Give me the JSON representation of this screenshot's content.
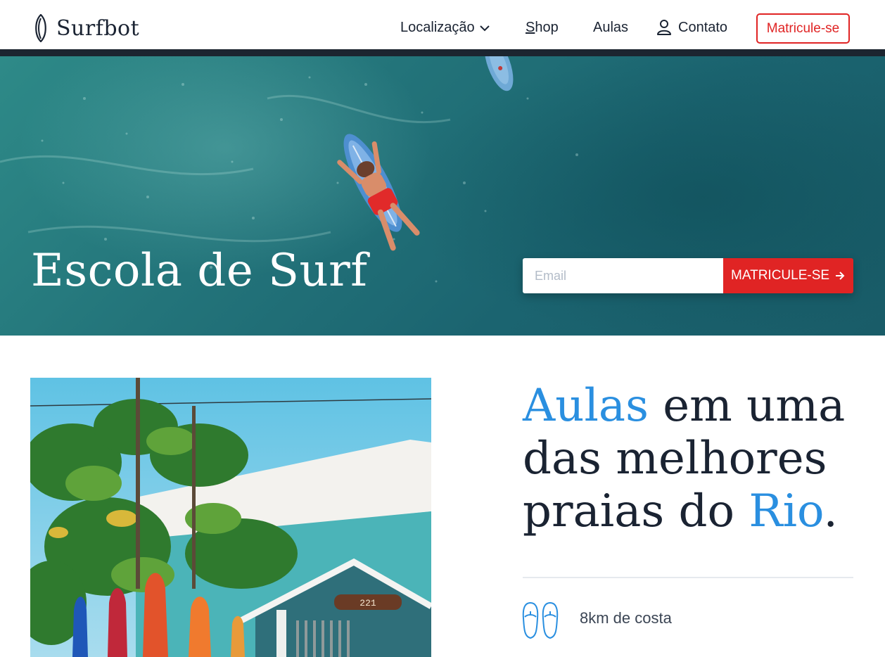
{
  "brand": {
    "name": "Surfbot",
    "logo_icon": "surfboard-logo-icon"
  },
  "nav": {
    "items": [
      {
        "label": "Localização",
        "icon": "chevron-down-icon"
      },
      {
        "label_first": "S",
        "label_rest": "hop"
      },
      {
        "label": "Aulas"
      },
      {
        "label": "Contato",
        "icon": "user-icon"
      }
    ],
    "cta": "Matricule-se"
  },
  "hero": {
    "title": "Escola de Surf",
    "email_placeholder": "Email",
    "submit_label": "MATRICULE-SE",
    "submit_icon": "arrow-right-icon"
  },
  "main": {
    "headline": {
      "w1": "Aulas",
      "w2": " em uma das melhores praias do ",
      "w3": "Rio",
      "w4": "."
    },
    "photo": {
      "house_number": "221"
    },
    "features": [
      {
        "icon": "flip-flops-icon",
        "text": "8km de costa"
      }
    ]
  },
  "colors": {
    "accent_red": "#e02424",
    "accent_blue": "#2a8fe0",
    "dark": "#1a2332"
  }
}
